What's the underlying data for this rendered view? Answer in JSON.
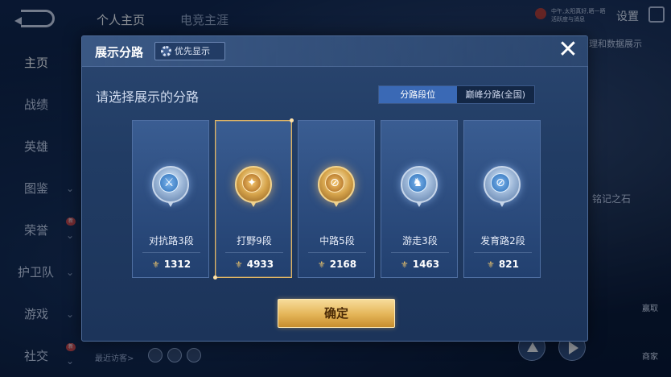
{
  "topbar": {
    "tabs": [
      "个人主页",
      "电竞主涯"
    ],
    "settings_label": "设置",
    "badge_line1": "中午,太阳真好,晒一晒",
    "badge_line2": "活跃度与消息"
  },
  "sidebar": {
    "items": [
      {
        "label": "主页",
        "chevron": ""
      },
      {
        "label": "战绩",
        "chevron": ""
      },
      {
        "label": "英雄",
        "chevron": ""
      },
      {
        "label": "图鉴",
        "chevron": "⌄"
      },
      {
        "label": "荣誉",
        "chevron": "⌄",
        "badge": "新"
      },
      {
        "label": "护卫队",
        "chevron": "⌄"
      },
      {
        "label": "游戏",
        "chevron": "⌄"
      },
      {
        "label": "社交",
        "chevron": "⌄",
        "badge": "新"
      }
    ],
    "recent_visitors": "最近访客>"
  },
  "background_right": {
    "top_text": "理和数据展示",
    "mid_text": "铭记之石",
    "btn1_label": "赢取",
    "btn2_label": "商家"
  },
  "modal": {
    "title": "展示分路",
    "priority_label": "优先显示",
    "subtitle": "请选择展示的分路",
    "segments": [
      "分路段位",
      "巅峰分路(全国)"
    ],
    "active_segment": 0,
    "lanes": [
      {
        "label": "对抗路3段",
        "score": "1312",
        "emblem": "silver",
        "glyph": "⚔",
        "selected": false
      },
      {
        "label": "打野9段",
        "score": "4933",
        "emblem": "gold",
        "glyph": "✦",
        "selected": true
      },
      {
        "label": "中路5段",
        "score": "2168",
        "emblem": "gold",
        "glyph": "⊘",
        "selected": false
      },
      {
        "label": "游走3段",
        "score": "1463",
        "emblem": "silver",
        "glyph": "♞",
        "selected": false
      },
      {
        "label": "发育路2段",
        "score": "821",
        "emblem": "silver",
        "glyph": "⊘",
        "selected": false
      }
    ],
    "confirm_label": "确定",
    "close_icon": "✕",
    "score_icon": "⚜"
  }
}
